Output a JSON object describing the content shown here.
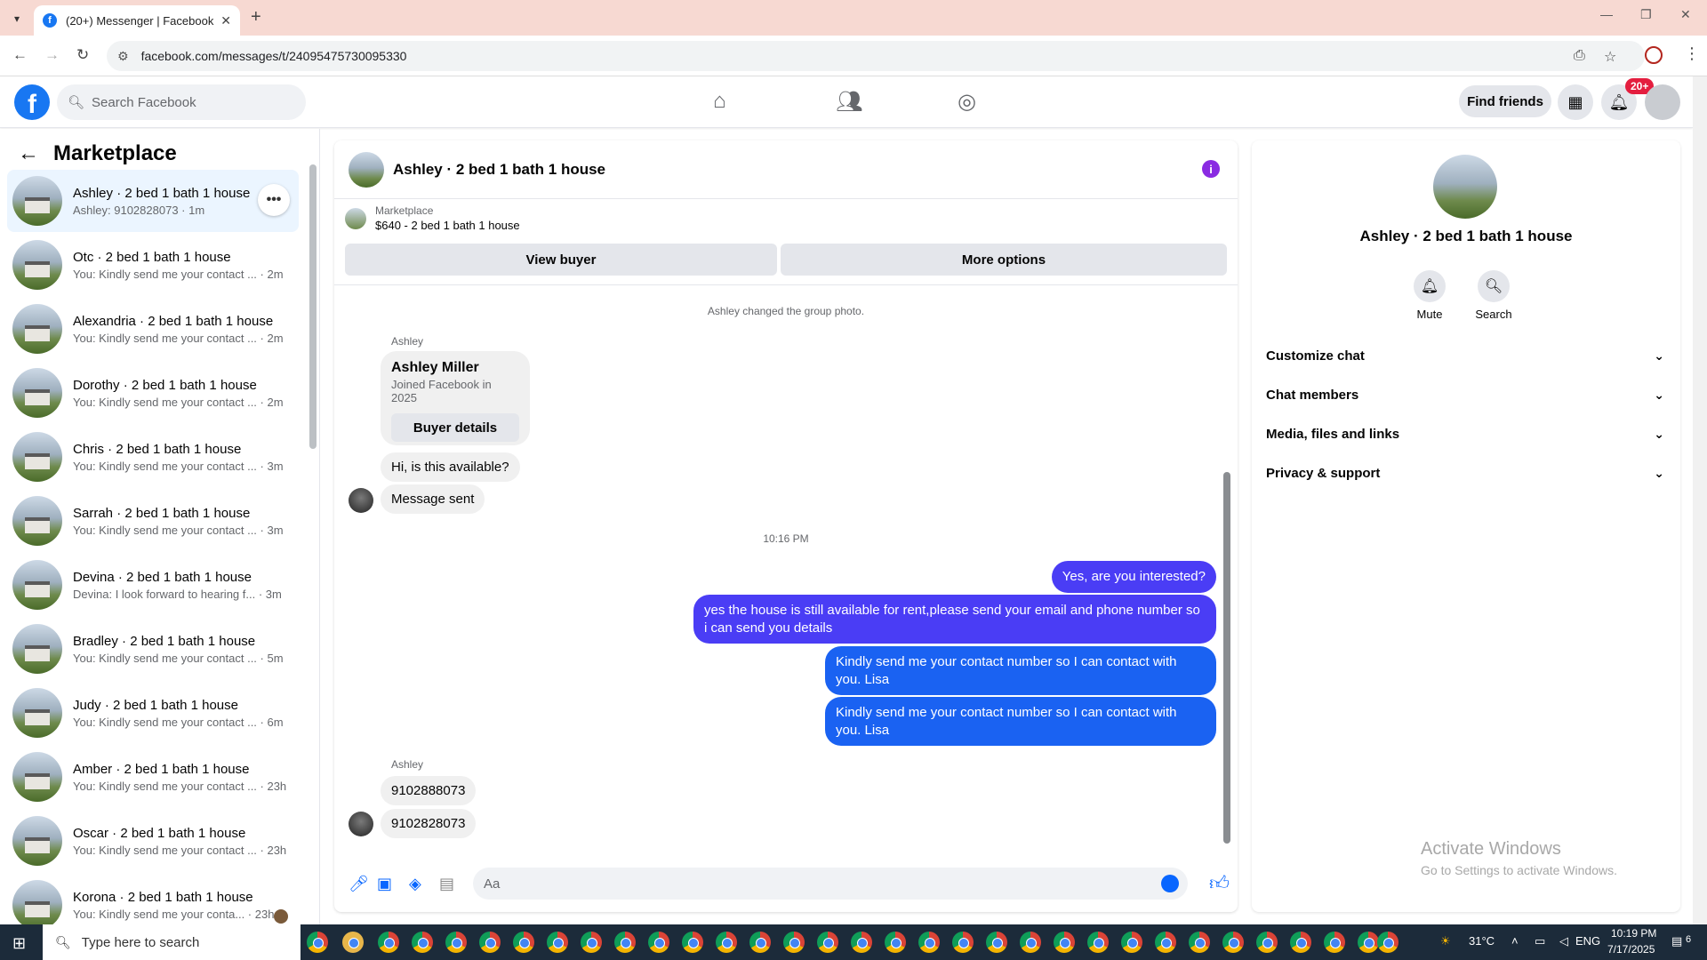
{
  "browser": {
    "tab_title": "(20+) Messenger | Facebook",
    "url": "facebook.com/messages/t/24095475730095330"
  },
  "header": {
    "search_placeholder": "Search Facebook",
    "find_friends": "Find friends",
    "notif_badge": "20+"
  },
  "left": {
    "title": "Marketplace",
    "conversations": [
      {
        "name": "Ashley · 2 bed 1 bath 1 house",
        "preview": "Ashley: 9102828073 · 1m"
      },
      {
        "name": "Otc · 2 bed 1 bath 1 house",
        "preview": "You: Kindly send me your contact ... · 2m"
      },
      {
        "name": "Alexandria · 2 bed 1 bath 1 house",
        "preview": "You: Kindly send me your contact ... · 2m"
      },
      {
        "name": "Dorothy · 2 bed 1 bath 1 house",
        "preview": "You: Kindly send me your contact ... · 2m"
      },
      {
        "name": "Chris · 2 bed 1 bath 1 house",
        "preview": "You: Kindly send me your contact ... · 3m"
      },
      {
        "name": "Sarrah · 2 bed 1 bath 1 house",
        "preview": "You: Kindly send me your contact ... · 3m"
      },
      {
        "name": "Devina · 2 bed 1 bath 1 house",
        "preview": "Devina: I look forward to hearing f... · 3m"
      },
      {
        "name": "Bradley · 2 bed 1 bath 1 house",
        "preview": "You: Kindly send me your contact ... · 5m"
      },
      {
        "name": "Judy · 2 bed 1 bath 1 house",
        "preview": "You: Kindly send me your contact ... · 6m"
      },
      {
        "name": "Amber · 2 bed 1 bath 1 house",
        "preview": "You: Kindly send me your contact ... · 23h"
      },
      {
        "name": "Oscar · 2 bed 1 bath 1 house",
        "preview": "You: Kindly send me your contact ... · 23h"
      },
      {
        "name": "Korona · 2 bed 1 bath 1 house",
        "preview": "You: Kindly send me your conta... · 23h"
      }
    ]
  },
  "chat": {
    "title": "Ashley · 2 bed 1 bath 1 house",
    "marketplace_label": "Marketplace",
    "listing": "$640 - 2 bed 1 bath 1 house",
    "view_buyer": "View buyer",
    "more_options": "More options",
    "sys_changed_photo": "Ashley changed the group photo.",
    "sender_name": "Ashley",
    "card_name": "Ashley Miller",
    "card_sub": "Joined Facebook in 2025",
    "card_button": "Buyer details",
    "msg_available": "Hi, is this available?",
    "msg_sent": "Message sent",
    "timestamp": "10:16 PM",
    "out_1": "Yes, are you interested?",
    "out_2": "yes the house is still available for rent,please send your email and phone number so i can send you details",
    "out_3": "Kindly send me your contact number so I can contact with you. Lisa",
    "out_4": "Kindly send me your contact number so I can contact with you. Lisa",
    "in_phone_1": "9102888073",
    "in_phone_2": "9102828073",
    "composer_placeholder": "Aa"
  },
  "right": {
    "name": "Ashley · 2 bed 1 bath 1 house",
    "mute": "Mute",
    "search": "Search",
    "sections": [
      "Customize chat",
      "Chat members",
      "Media, files and links",
      "Privacy & support"
    ],
    "watermark_title": "Activate Windows",
    "watermark_sub": "Go to Settings to activate Windows."
  },
  "taskbar": {
    "search_placeholder": "Type here to search",
    "temp": "31°C",
    "lang": "ENG",
    "time": "10:19 PM",
    "date": "7/17/2025",
    "notif_count": "6"
  },
  "colors": {
    "fb_blue": "#1877f2",
    "outgoing_purple": "#4a3df5",
    "outgoing_blue": "#1a62f2",
    "notif_red": "#e41e3f"
  }
}
